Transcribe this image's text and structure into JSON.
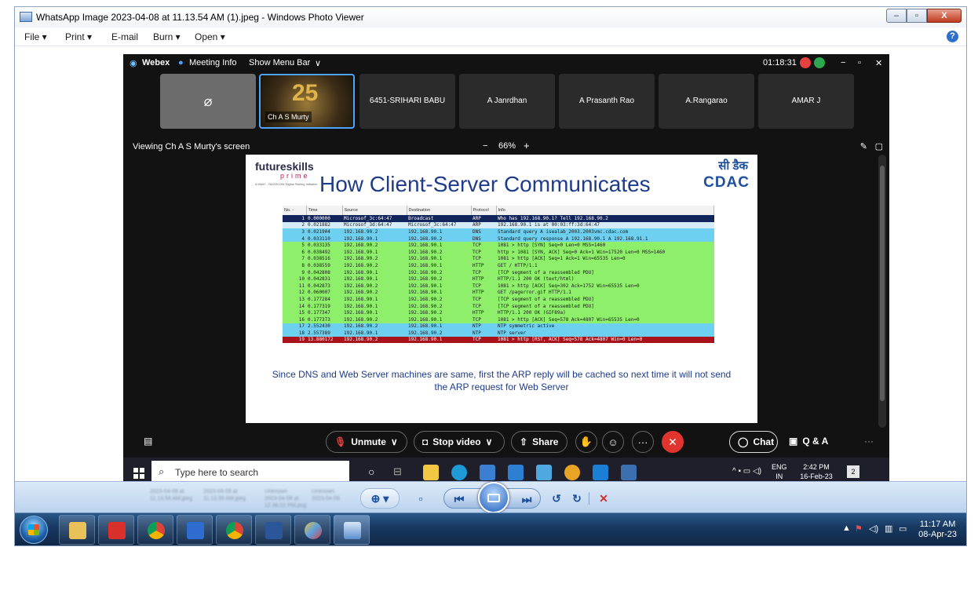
{
  "window": {
    "title": "WhatsApp Image 2023-04-08 at 11.13.54 AM (1).jpeg - Windows Photo Viewer",
    "minimize": "–",
    "maximize": "▫",
    "close": "X"
  },
  "menu": {
    "file": "File  ▾",
    "print": "Print  ▾",
    "email": "E-mail",
    "burn": "Burn  ▾",
    "open": "Open  ▾",
    "help": "?"
  },
  "webex": {
    "brand": "Webex",
    "meeting_info": "Meeting Info",
    "show_menu_bar": "Show Menu Bar",
    "timer": "01:18:31",
    "participants": [
      {
        "name": ""
      },
      {
        "name": "Ch A S Murty"
      },
      {
        "name": "6451-SRIHARI BABU"
      },
      {
        "name": "A Janrdhan"
      },
      {
        "name": "A Prasanth Rao"
      },
      {
        "name": "A.Rangarao"
      },
      {
        "name": "AMAR J"
      }
    ],
    "viewing": "Viewing Ch A S Murty's screen",
    "zoom_minus": "−",
    "zoom": "66%",
    "zoom_plus": "+",
    "controls": {
      "unmute": "Unmute",
      "stop_video": "Stop video",
      "share": "Share",
      "chat": "Chat",
      "qa": "Q & A",
      "more": "···",
      "leave": "✕"
    }
  },
  "slide": {
    "brand": "futureskills",
    "brand_sub": "prime",
    "brand_tag": "A MeitY - NASSCOM Digital Skilling Initiative",
    "title": "How Client-Server Communicates",
    "logo_hindi": "सी डैक",
    "logo": "CDAC",
    "headers": [
      "No. -",
      "Time",
      "Source",
      "Destination",
      "Protocol",
      "Info"
    ],
    "packets": [
      {
        "no": "1",
        "time": "0.000000",
        "src": "Microsof_3c:64:47",
        "dst": "Broadcast",
        "proto": "ARP",
        "info": "Who has 192.168.90.1?  Tell 192.168.90.2",
        "bg": "#12245c",
        "fg": "#ffffff"
      },
      {
        "no": "2",
        "time": "0.021882",
        "src": "Microsof_3d:64:47",
        "dst": "Microsof_3c:64:47",
        "proto": "ARP",
        "info": "192.168.90.1 is at 00:03:ff:3d:64:47",
        "bg": "#d6ecf7",
        "fg": "#1a1a1a"
      },
      {
        "no": "3",
        "time": "0.021904",
        "src": "192.168.90.2",
        "dst": "192.168.90.1",
        "proto": "DNS",
        "info": "Standard query A isealab_2003.2003vmc.cdac.com",
        "bg": "#6ed0f0",
        "fg": "#1a1a1a"
      },
      {
        "no": "4",
        "time": "0.033110",
        "src": "192.168.90.1",
        "dst": "192.168.90.2",
        "proto": "DNS",
        "info": "Standard query response A 192.168.90.1 A 192.168.91.1",
        "bg": "#6ed0f0",
        "fg": "#1a1a1a"
      },
      {
        "no": "5",
        "time": "0.033135",
        "src": "192.168.90.2",
        "dst": "192.168.90.1",
        "proto": "TCP",
        "info": "1081 > http [SYN] Seq=0 Len=0 MSS=1460",
        "bg": "#8ef06a",
        "fg": "#1a1a1a"
      },
      {
        "no": "6",
        "time": "0.038492",
        "src": "192.168.90.1",
        "dst": "192.168.90.2",
        "proto": "TCP",
        "info": "http > 1081 [SYN, ACK] Seq=0 Ack=1 Win=17520 Len=0 MSS=1460",
        "bg": "#8ef06a",
        "fg": "#1a1a1a"
      },
      {
        "no": "7",
        "time": "0.038516",
        "src": "192.168.90.2",
        "dst": "192.168.90.1",
        "proto": "TCP",
        "info": "1081 > http [ACK] Seq=1 Ack=1 Win=65535 Len=0",
        "bg": "#8ef06a",
        "fg": "#1a1a1a"
      },
      {
        "no": "8",
        "time": "0.038559",
        "src": "192.168.90.2",
        "dst": "192.168.90.1",
        "proto": "HTTP",
        "info": "GET / HTTP/1.1",
        "bg": "#8ef06a",
        "fg": "#1a1a1a"
      },
      {
        "no": "9",
        "time": "0.042808",
        "src": "192.168.90.1",
        "dst": "192.168.90.2",
        "proto": "TCP",
        "info": "[TCP segment of a reassembled PDU]",
        "bg": "#8ef06a",
        "fg": "#1a1a1a"
      },
      {
        "no": "10",
        "time": "0.042831",
        "src": "192.168.90.1",
        "dst": "192.168.90.2",
        "proto": "HTTP",
        "info": "HTTP/1.1 200 OK (text/html)",
        "bg": "#8ef06a",
        "fg": "#1a1a1a"
      },
      {
        "no": "11",
        "time": "0.042873",
        "src": "192.168.90.2",
        "dst": "192.168.90.1",
        "proto": "TCP",
        "info": "1081 > http [ACK] Seq=302 Ack=1752 Win=65535 Len=0",
        "bg": "#8ef06a",
        "fg": "#1a1a1a"
      },
      {
        "no": "12",
        "time": "0.060007",
        "src": "192.168.90.2",
        "dst": "192.168.90.1",
        "proto": "HTTP",
        "info": "GET /pagerror.gif HTTP/1.1",
        "bg": "#8ef06a",
        "fg": "#1a1a1a"
      },
      {
        "no": "13",
        "time": "0.177284",
        "src": "192.168.90.1",
        "dst": "192.168.90.2",
        "proto": "TCP",
        "info": "[TCP segment of a reassembled PDU]",
        "bg": "#8ef06a",
        "fg": "#1a1a1a"
      },
      {
        "no": "14",
        "time": "0.177319",
        "src": "192.168.90.1",
        "dst": "192.168.90.2",
        "proto": "TCP",
        "info": "[TCP segment of a reassembled PDU]",
        "bg": "#8ef06a",
        "fg": "#1a1a1a"
      },
      {
        "no": "15",
        "time": "0.177347",
        "src": "192.168.90.1",
        "dst": "192.168.90.2",
        "proto": "HTTP",
        "info": "HTTP/1.1 200 OK (GIF89a)",
        "bg": "#8ef06a",
        "fg": "#1a1a1a"
      },
      {
        "no": "16",
        "time": "0.177373",
        "src": "192.168.90.2",
        "dst": "192.168.90.1",
        "proto": "TCP",
        "info": "1081 > http [ACK] Seq=578 Ack=4807 Win=65535 Len=0",
        "bg": "#8ef06a",
        "fg": "#1a1a1a"
      },
      {
        "no": "17",
        "time": "2.552430",
        "src": "192.168.90.2",
        "dst": "192.168.90.1",
        "proto": "NTP",
        "info": "NTP symmetric active",
        "bg": "#6ed0f0",
        "fg": "#1a1a1a"
      },
      {
        "no": "18",
        "time": "2.557389",
        "src": "192.168.90.1",
        "dst": "192.168.90.2",
        "proto": "NTP",
        "info": "NTP server",
        "bg": "#6ed0f0",
        "fg": "#1a1a1a"
      },
      {
        "no": "19",
        "time": "13.880172",
        "src": "192.168.90.2",
        "dst": "192.168.90.1",
        "proto": "TCP",
        "info": "1081 > http [RST, ACK] Seq=578 Ack=4807 Win=0 Len=0",
        "bg": "#a8121b",
        "fg": "#ffffff"
      }
    ],
    "caption": "Since DNS and Web Server machines are same, first the ARP reply will be cached so next time it will not send the ARP request for Web Server"
  },
  "taskbar10": {
    "search_placeholder": "Type here to search",
    "lang": "ENG",
    "region": "IN",
    "time": "2:42 PM",
    "date": "16-Feb-23",
    "notif_count": "2"
  },
  "viewer_toolbar": {
    "zoom_label": "⊕ ▾",
    "fit_label": "▫",
    "prev": "⏮",
    "next": "⏭",
    "rotate_ccw": "↺",
    "rotate_cw": "↻",
    "delete": "✕"
  },
  "taskbar7": {
    "time": "11:17 AM",
    "date": "08-Apr-23"
  }
}
